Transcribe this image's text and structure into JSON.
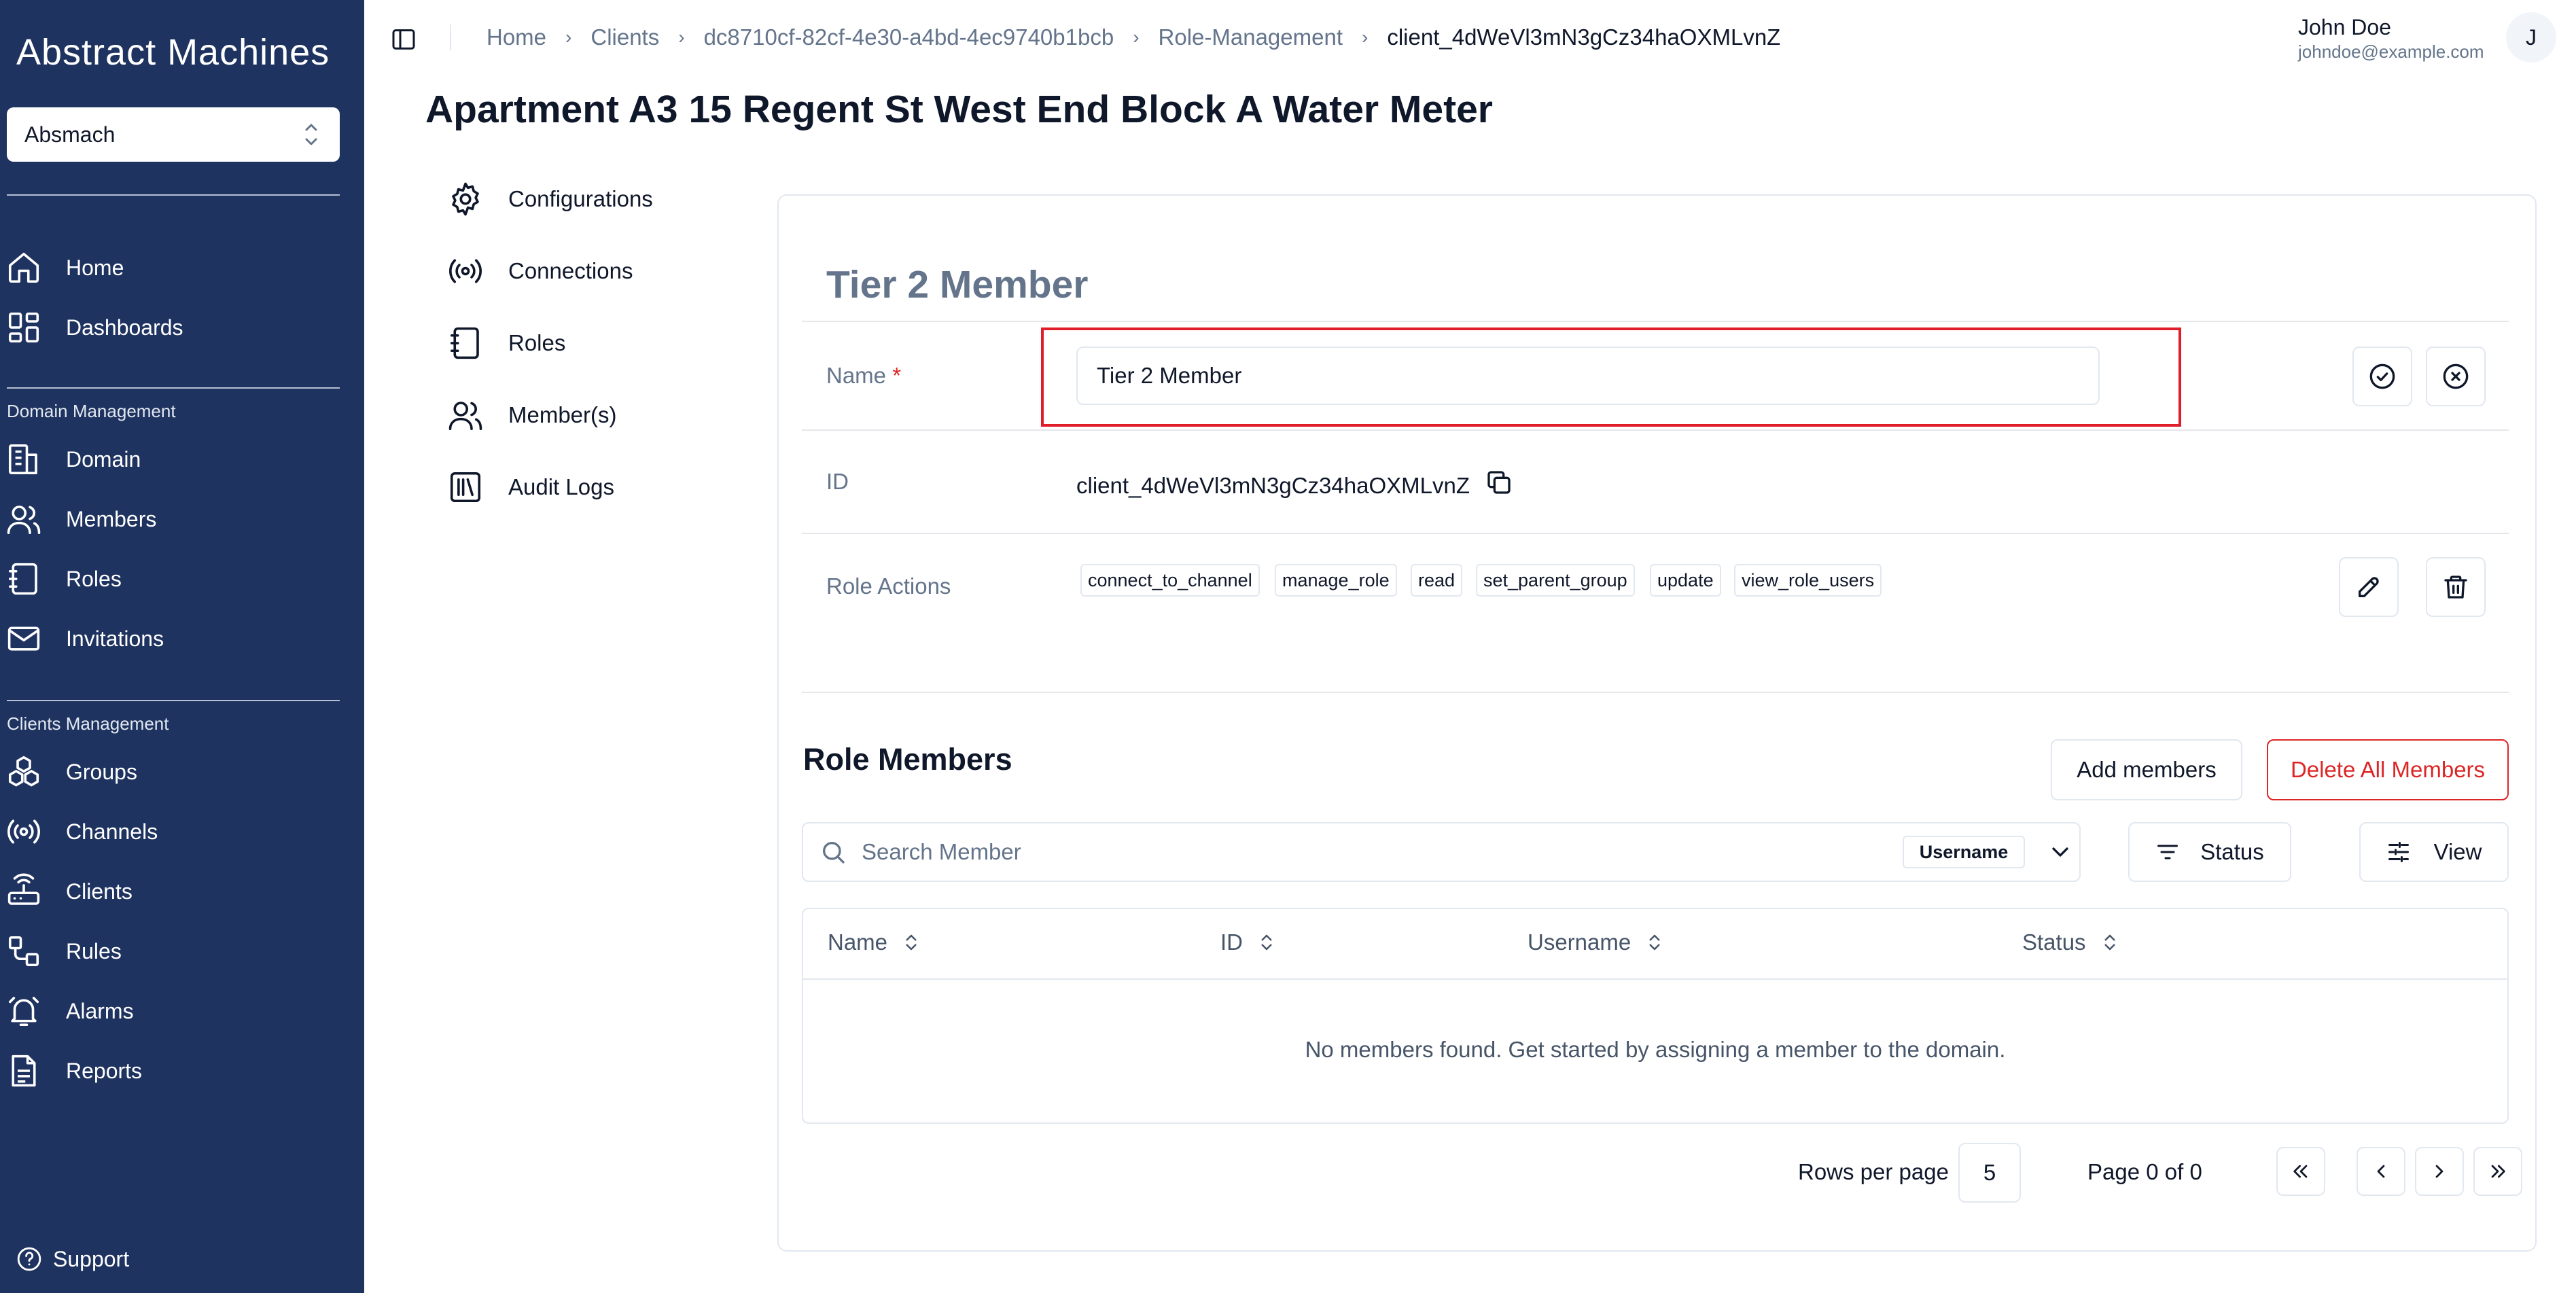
{
  "sidebar": {
    "logo": "Abstract Machines",
    "org_select": "Absmach",
    "top_items": [
      {
        "label": "Home",
        "icon": "home-icon"
      },
      {
        "label": "Dashboards",
        "icon": "dashboard-icon"
      }
    ],
    "sections": [
      {
        "title": "Domain Management",
        "items": [
          {
            "label": "Domain",
            "icon": "domain-icon"
          },
          {
            "label": "Members",
            "icon": "members-icon"
          },
          {
            "label": "Roles",
            "icon": "roles-icon"
          },
          {
            "label": "Invitations",
            "icon": "mail-icon"
          }
        ]
      },
      {
        "title": "Clients Management",
        "items": [
          {
            "label": "Groups",
            "icon": "groups-icon"
          },
          {
            "label": "Channels",
            "icon": "channels-icon"
          },
          {
            "label": "Clients",
            "icon": "clients-icon"
          },
          {
            "label": "Rules",
            "icon": "rules-icon"
          },
          {
            "label": "Alarms",
            "icon": "alarm-icon"
          },
          {
            "label": "Reports",
            "icon": "reports-icon"
          }
        ]
      }
    ],
    "support": "Support"
  },
  "header": {
    "breadcrumb": [
      "Home",
      "Clients",
      "dc8710cf-82cf-4e30-a4bd-4ec9740b1bcb",
      "Role-Management",
      "client_4dWeVl3mN3gCz34haOXMLvnZ"
    ],
    "user_name": "John Doe",
    "user_email": "johndoe@example.com",
    "avatar_initial": "J"
  },
  "page_title": "Apartment A3 15 Regent St West End Block A Water Meter",
  "subnav": [
    {
      "label": "Configurations",
      "icon": "gear-icon"
    },
    {
      "label": "Connections",
      "icon": "broadcast-icon"
    },
    {
      "label": "Roles",
      "icon": "notebook-icon"
    },
    {
      "label": "Member(s)",
      "icon": "members-icon"
    },
    {
      "label": "Audit Logs",
      "icon": "audit-logs-icon"
    }
  ],
  "role": {
    "title": "Tier 2 Member",
    "name_label": "Name",
    "name_required": "*",
    "name_value": "Tier 2 Member",
    "id_label": "ID",
    "id_value": "client_4dWeVl3mN3gCz34haOXMLvnZ",
    "actions_label": "Role Actions",
    "actions": [
      "connect_to_channel",
      "manage_role",
      "read",
      "set_parent_group",
      "update",
      "view_role_users"
    ]
  },
  "members": {
    "title": "Role Members",
    "add_button": "Add members",
    "delete_all_button": "Delete All Members",
    "search_placeholder": "Search Member",
    "filter_field": "Username",
    "status_button": "Status",
    "view_button": "View",
    "columns": [
      "Name",
      "ID",
      "Username",
      "Status"
    ],
    "empty_message": "No members found. Get started by assigning a member to the domain.",
    "rows_per_page_label": "Rows per page",
    "rows_per_page": "5",
    "page_info": "Page 0 of 0"
  },
  "colors": {
    "sidebar_bg": "#1f3360",
    "highlight_border": "#e11d2a",
    "danger": "#dc2626"
  }
}
